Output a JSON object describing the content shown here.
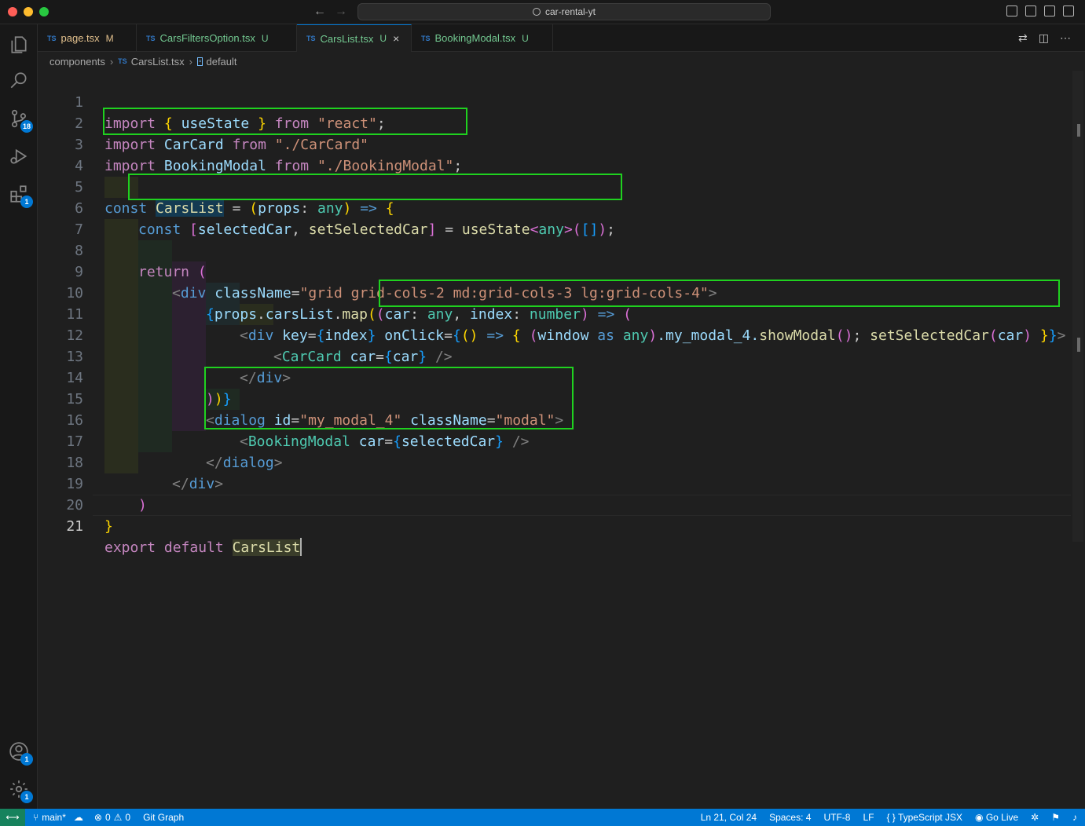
{
  "window": {
    "search_text": "car-rental-yt"
  },
  "activity_bar": {
    "scm_badge": "18",
    "extensions_badge": "1",
    "accounts_badge": "1",
    "settings_badge": "1"
  },
  "tabs": [
    {
      "lang": "TS",
      "label": "page.tsx",
      "status": "M"
    },
    {
      "lang": "TS",
      "label": "CarsFiltersOption.tsx",
      "status": "U"
    },
    {
      "lang": "TS",
      "label": "CarsList.tsx",
      "status": "U"
    },
    {
      "lang": "TS",
      "label": "BookingModal.tsx",
      "status": "U"
    }
  ],
  "breadcrumb": {
    "folder": "components",
    "file_lang": "TS",
    "file": "CarsList.tsx",
    "symbol": "default"
  },
  "line_numbers": [
    "1",
    "2",
    "3",
    "4",
    "5",
    "6",
    "7",
    "8",
    "9",
    "10",
    "11",
    "12",
    "13",
    "14",
    "15",
    "16",
    "17",
    "18",
    "19",
    "20",
    "21"
  ],
  "code": {
    "l1": [
      "import",
      "{",
      "useState",
      "}",
      "from",
      "\"react\"",
      ";"
    ],
    "l2": [
      "import",
      "CarCard",
      "from",
      "\"./CarCard\""
    ],
    "l3": [
      "import",
      "BookingModal",
      "from",
      "\"./BookingModal\"",
      ";"
    ],
    "l5": [
      "const",
      "CarsList",
      "=",
      "(",
      "props",
      ":",
      "any",
      ")",
      "=>",
      "{"
    ],
    "l6": [
      "const",
      "[",
      "selectedCar",
      ",",
      "setSelectedCar",
      "]",
      "=",
      "useState",
      "<",
      "any",
      ">",
      "(",
      "[]",
      ")",
      ";"
    ],
    "l8": [
      "return",
      "("
    ],
    "l9": [
      "<",
      "div",
      "className",
      "=",
      "\"grid grid-cols-2 md:grid-cols-3 lg:grid-cols-4\"",
      ">"
    ],
    "l10": [
      "{",
      "props",
      ".",
      "carsList",
      ".",
      "map",
      "(",
      "(",
      "car",
      ":",
      "any",
      ",",
      "index",
      ":",
      "number",
      ")",
      "=>",
      "("
    ],
    "l11": [
      "<",
      "div",
      "key",
      "=",
      "{",
      "index",
      "}",
      "onClick",
      "=",
      "{",
      "()",
      "=>",
      "{",
      "(",
      "window",
      "as",
      "any",
      ")",
      ".my_modal_4.",
      "showModal",
      "()",
      ";",
      "setSelectedCar",
      "(",
      "car",
      ")",
      "}",
      "}",
      ">"
    ],
    "l12": [
      "<",
      "CarCard",
      "car",
      "=",
      "{",
      "car",
      "}",
      "/>"
    ],
    "l13": [
      "</",
      "div",
      ">"
    ],
    "l14": [
      ")",
      ")",
      "}"
    ],
    "l15": [
      "<",
      "dialog",
      "id",
      "=",
      "\"my_modal_4\"",
      "className",
      "=",
      "\"modal\"",
      ">"
    ],
    "l16": [
      "<",
      "BookingModal",
      "car",
      "=",
      "{",
      "selectedCar",
      "}",
      "/>"
    ],
    "l17": [
      "</",
      "dialog",
      ">"
    ],
    "l18": [
      "</",
      "div",
      ">"
    ],
    "l19": [
      ")"
    ],
    "l20": [
      "}"
    ],
    "l21": [
      "export",
      "default",
      "CarsList"
    ]
  },
  "status_bar": {
    "branch": "main*",
    "errors": "0",
    "warnings": "0",
    "git_graph": "Git Graph",
    "position": "Ln 21, Col 24",
    "spaces": "Spaces: 4",
    "encoding": "UTF-8",
    "eol": "LF",
    "language": "TypeScript JSX",
    "go_live": "Go Live"
  },
  "colors": {
    "accent": "#0078d4",
    "highlight_box": "#1fd11f",
    "editor_bg": "#1f1f1f"
  }
}
